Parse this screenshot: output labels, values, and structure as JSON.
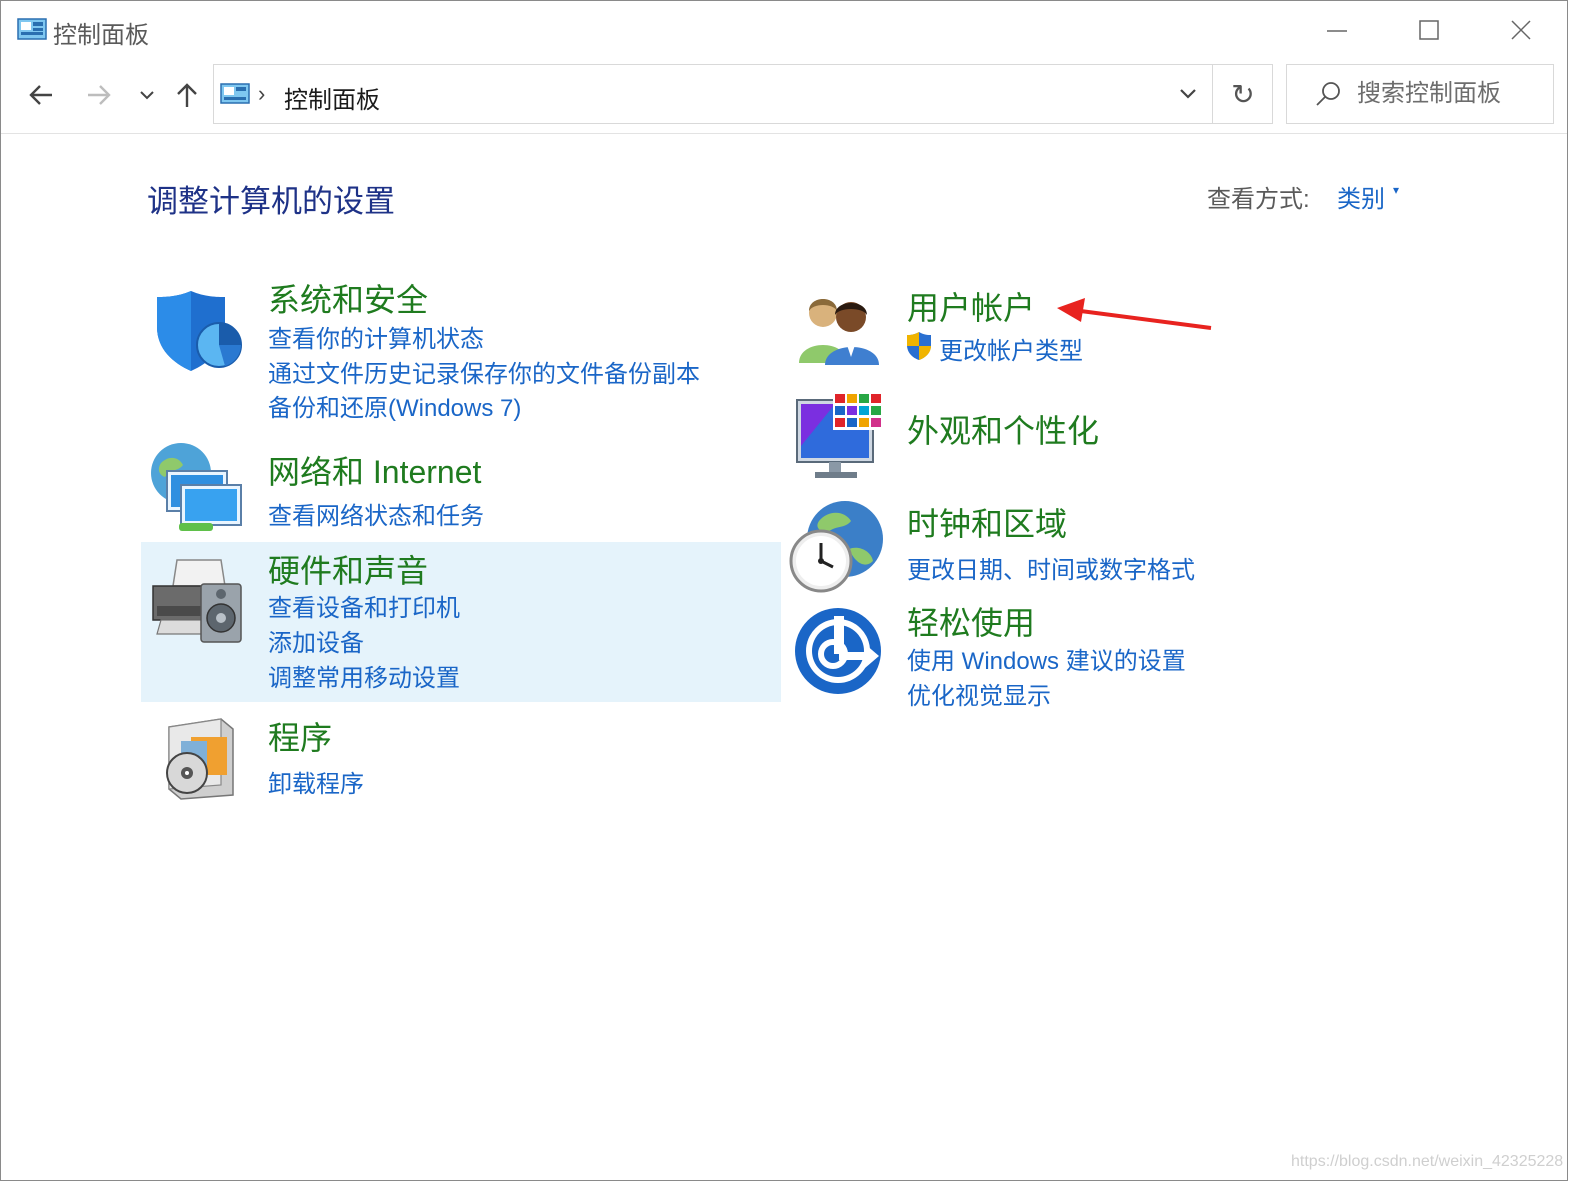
{
  "window": {
    "title": "控制面板",
    "minimize_icon": "minimize-icon",
    "maximize_icon": "maximize-icon",
    "close_icon": "close-icon"
  },
  "nav": {
    "address": "控制面板",
    "search_placeholder": "搜索控制面板"
  },
  "content": {
    "title": "调整计算机的设置",
    "view_by_label": "查看方式:",
    "view_by_value": "类别"
  },
  "categories": {
    "system_security": {
      "title": "系统和安全",
      "icon": "shield-icon",
      "links": [
        "查看你的计算机状态",
        "通过文件历史记录保存你的文件备份副本",
        "备份和还原(Windows 7)"
      ]
    },
    "network": {
      "title": "网络和 Internet",
      "icon": "network-globe-icon",
      "links": [
        "查看网络状态和任务"
      ]
    },
    "hardware": {
      "title": "硬件和声音",
      "icon": "printer-speaker-icon",
      "links": [
        "查看设备和打印机",
        "添加设备",
        "调整常用移动设置"
      ]
    },
    "programs": {
      "title": "程序",
      "icon": "programs-disc-icon",
      "links": [
        "卸载程序"
      ]
    },
    "user_accounts": {
      "title": "用户帐户",
      "icon": "users-icon",
      "links": [
        "更改帐户类型"
      ]
    },
    "appearance": {
      "title": "外观和个性化",
      "icon": "monitor-palette-icon",
      "links": []
    },
    "clock_region": {
      "title": "时钟和区域",
      "icon": "clock-globe-icon",
      "links": [
        "更改日期、时间或数字格式"
      ]
    },
    "ease_access": {
      "title": "轻松使用",
      "icon": "ease-of-access-icon",
      "links": [
        "使用 Windows 建议的设置",
        "优化视觉显示"
      ]
    }
  },
  "annotation": {
    "arrow_color": "#e8231f"
  },
  "colors": {
    "category_title": "#1f7b1f",
    "link": "#1a66c7",
    "page_title": "#1e3287",
    "hover_bg": "#e5f3fb"
  },
  "watermark": "https://blog.csdn.net/weixin_42325228"
}
